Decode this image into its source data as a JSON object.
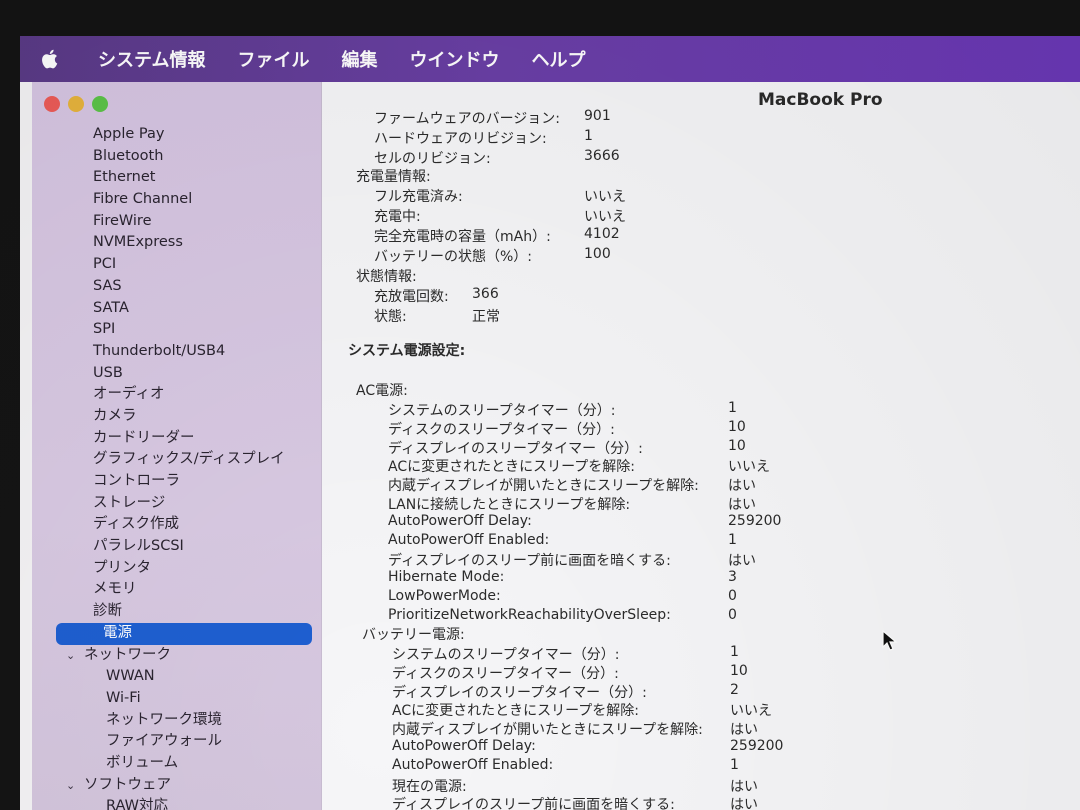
{
  "menubar": {
    "app_name": "システム情報",
    "items": [
      "ファイル",
      "編集",
      "ウインドウ",
      "ヘルプ"
    ]
  },
  "window": {
    "title": "MacBook Pro"
  },
  "sidebar": {
    "items": [
      {
        "label": "Apple Pay",
        "kind": "sub"
      },
      {
        "label": "Bluetooth",
        "kind": "sub"
      },
      {
        "label": "Ethernet",
        "kind": "sub"
      },
      {
        "label": "Fibre Channel",
        "kind": "sub"
      },
      {
        "label": "FireWire",
        "kind": "sub"
      },
      {
        "label": "NVMExpress",
        "kind": "sub"
      },
      {
        "label": "PCI",
        "kind": "sub"
      },
      {
        "label": "SAS",
        "kind": "sub"
      },
      {
        "label": "SATA",
        "kind": "sub"
      },
      {
        "label": "SPI",
        "kind": "sub"
      },
      {
        "label": "Thunderbolt/USB4",
        "kind": "sub"
      },
      {
        "label": "USB",
        "kind": "sub"
      },
      {
        "label": "オーディオ",
        "kind": "sub"
      },
      {
        "label": "カメラ",
        "kind": "sub"
      },
      {
        "label": "カードリーダー",
        "kind": "sub"
      },
      {
        "label": "グラフィックス/ディスプレイ",
        "kind": "sub"
      },
      {
        "label": "コントローラ",
        "kind": "sub"
      },
      {
        "label": "ストレージ",
        "kind": "sub"
      },
      {
        "label": "ディスク作成",
        "kind": "sub"
      },
      {
        "label": "パラレルSCSI",
        "kind": "sub"
      },
      {
        "label": "プリンタ",
        "kind": "sub"
      },
      {
        "label": "メモリ",
        "kind": "sub"
      },
      {
        "label": "診断",
        "kind": "sub"
      },
      {
        "label": "電源",
        "kind": "selected"
      },
      {
        "label": "ネットワーク",
        "kind": "group"
      },
      {
        "label": "WWAN",
        "kind": "sub2"
      },
      {
        "label": "Wi-Fi",
        "kind": "sub2"
      },
      {
        "label": "ネットワーク環境",
        "kind": "sub2"
      },
      {
        "label": "ファイアウォール",
        "kind": "sub2"
      },
      {
        "label": "ボリューム",
        "kind": "sub2"
      },
      {
        "label": "ソフトウェア",
        "kind": "group"
      },
      {
        "label": "RAW対応",
        "kind": "sub2"
      }
    ]
  },
  "content": {
    "battery_top": [
      {
        "k": "ファームウェアのバージョン:",
        "v": "901"
      },
      {
        "k": "ハードウェアのリビジョン:",
        "v": "1"
      },
      {
        "k": "セルのリビジョン:",
        "v": "3666"
      }
    ],
    "charge_header": "充電量情報:",
    "charge": [
      {
        "k": "フル充電済み:",
        "v": "いいえ"
      },
      {
        "k": "充電中:",
        "v": "いいえ"
      },
      {
        "k": "完全充電時の容量（mAh）:",
        "v": "4102"
      },
      {
        "k": "バッテリーの状態（%）:",
        "v": "100"
      }
    ],
    "status_header": "状態情報:",
    "status": [
      {
        "k": "充放電回数:",
        "v": "366"
      },
      {
        "k": "状態:",
        "v": "正常"
      }
    ],
    "power_settings_header": "システム電源設定:",
    "ac_header": "AC電源:",
    "ac": [
      {
        "k": "システムのスリープタイマー（分）:",
        "v": "1"
      },
      {
        "k": "ディスクのスリープタイマー（分）:",
        "v": "10"
      },
      {
        "k": "ディスプレイのスリープタイマー（分）:",
        "v": "10"
      },
      {
        "k": "ACに変更されたときにスリープを解除:",
        "v": "いいえ"
      },
      {
        "k": "内蔵ディスプレイが開いたときにスリープを解除:",
        "v": "はい"
      },
      {
        "k": "LANに接続したときにスリープを解除:",
        "v": "はい"
      },
      {
        "k": "AutoPowerOff Delay:",
        "v": "259200"
      },
      {
        "k": "AutoPowerOff Enabled:",
        "v": "1"
      },
      {
        "k": "ディスプレイのスリープ前に画面を暗くする:",
        "v": "はい"
      },
      {
        "k": "Hibernate Mode:",
        "v": "3"
      },
      {
        "k": "LowPowerMode:",
        "v": "0"
      },
      {
        "k": "PrioritizeNetworkReachabilityOverSleep:",
        "v": "0"
      }
    ],
    "battery_power_header": "バッテリー電源:",
    "battery_power": [
      {
        "k": "システムのスリープタイマー（分）:",
        "v": "1"
      },
      {
        "k": "ディスクのスリープタイマー（分）:",
        "v": "10"
      },
      {
        "k": "ディスプレイのスリープタイマー（分）:",
        "v": "2"
      },
      {
        "k": "ACに変更されたときにスリープを解除:",
        "v": "いいえ"
      },
      {
        "k": "内蔵ディスプレイが開いたときにスリープを解除:",
        "v": "はい"
      },
      {
        "k": "AutoPowerOff Delay:",
        "v": "259200"
      },
      {
        "k": "AutoPowerOff Enabled:",
        "v": "1"
      },
      {
        "k": "現在の電源:",
        "v": "はい"
      },
      {
        "k": "ディスプレイのスリープ前に画面を暗くする:",
        "v": "はい"
      }
    ]
  }
}
